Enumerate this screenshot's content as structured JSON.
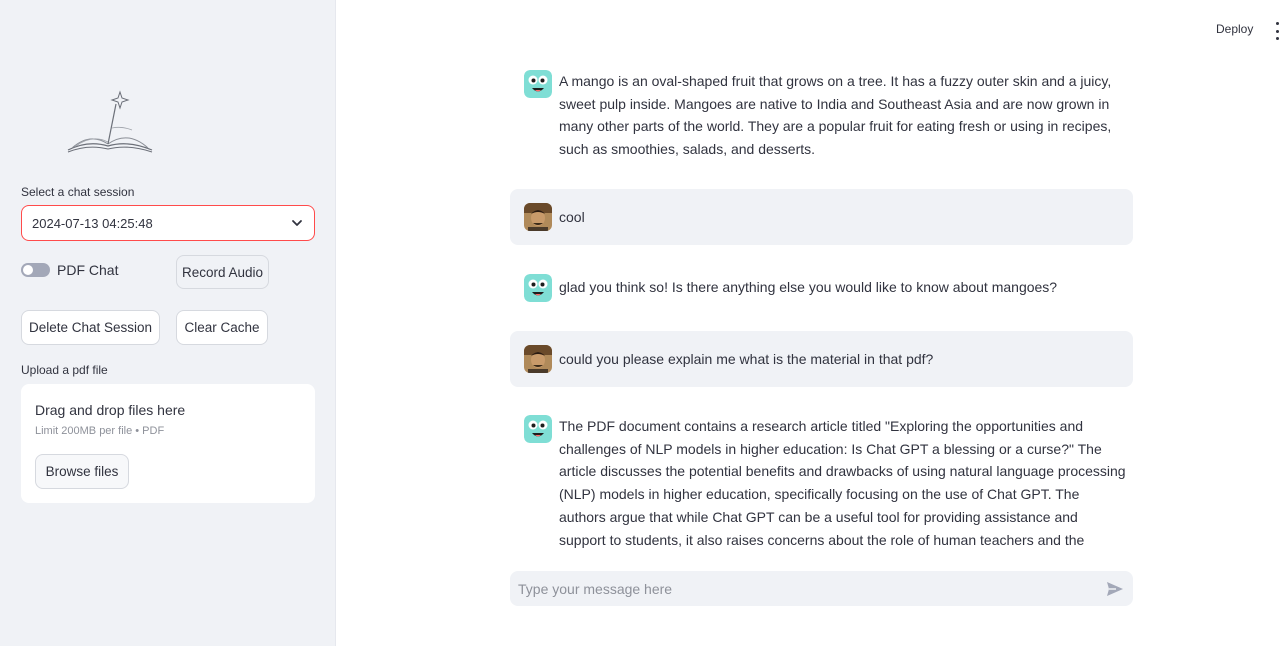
{
  "sidebar": {
    "session_label": "Select a chat session",
    "session_value": "2024-07-13 04:25:48",
    "pdf_chat_label": "PDF Chat",
    "record_audio_label": "Record Audio",
    "delete_session_label": "Delete Chat Session",
    "clear_cache_label": "Clear Cache",
    "upload_label": "Upload a pdf file",
    "uploader": {
      "drag_text": "Drag and drop files here",
      "limit_text": "Limit 200MB per file • PDF",
      "browse_label": "Browse files"
    }
  },
  "header": {
    "deploy_label": "Deploy"
  },
  "messages": [
    {
      "role": "assistant",
      "text": "A mango is an oval-shaped fruit that grows on a tree. It has a fuzzy outer skin and a juicy, sweet pulp inside. Mangoes are native to India and Southeast Asia and are now grown in many other parts of the world. They are a popular fruit for eating fresh or using in recipes, such as smoothies, salads, and desserts."
    },
    {
      "role": "user",
      "text": "cool"
    },
    {
      "role": "assistant",
      "text": "glad you think so! Is there anything else you would like to know about mangoes?"
    },
    {
      "role": "user",
      "text": "could you please explain me what is the material in that pdf?"
    },
    {
      "role": "assistant",
      "text": "The PDF document contains a research article titled \"Exploring the opportunities and challenges of NLP models in higher education: Is Chat GPT a blessing or a curse?\" The article discusses the potential benefits and drawbacks of using natural language processing (NLP) models in higher education, specifically focusing on the use of Chat GPT. The authors argue that while Chat GPT can be a useful tool for providing assistance and support to students, it also raises concerns about the role of human teachers and the potential for misinformation and bias. The article is"
    }
  ],
  "chat_input": {
    "placeholder": "Type your message here"
  },
  "icons": {
    "bot_avatar": "bot-avatar-icon",
    "user_avatar": "user-avatar-icon",
    "send": "send-icon",
    "chevron": "chevron-down-icon",
    "menu": "kebab-menu-icon"
  },
  "colors": {
    "accent": "#ff4b4b",
    "sidebar_bg": "#f0f2f6",
    "bot_avatar": "#7fded5"
  }
}
